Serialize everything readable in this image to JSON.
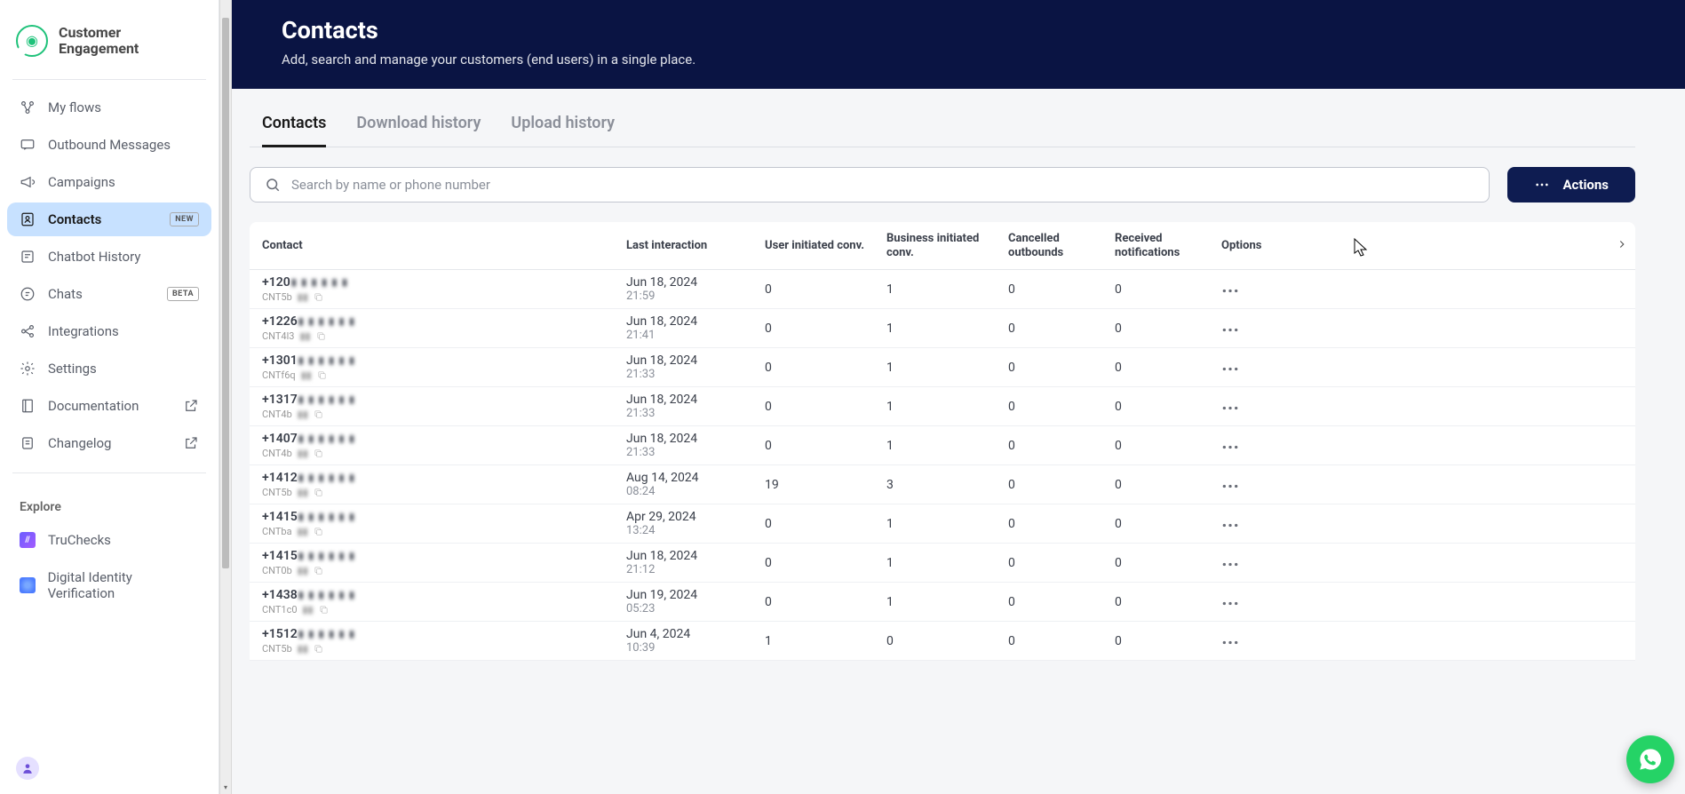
{
  "brand": {
    "line1": "Customer",
    "line2": "Engagement"
  },
  "sidebar": {
    "items": [
      {
        "label": "My flows"
      },
      {
        "label": "Outbound Messages"
      },
      {
        "label": "Campaigns"
      },
      {
        "label": "Contacts",
        "badge": "NEW"
      },
      {
        "label": "Chatbot History"
      },
      {
        "label": "Chats",
        "badge": "BETA"
      },
      {
        "label": "Integrations"
      },
      {
        "label": "Settings"
      },
      {
        "label": "Documentation"
      },
      {
        "label": "Changelog"
      }
    ],
    "explore_label": "Explore",
    "explore_items": [
      {
        "label": "TruChecks"
      },
      {
        "label": "Digital Identity Verification"
      }
    ]
  },
  "hero": {
    "title": "Contacts",
    "subtitle": "Add, search and manage your customers (end users) in a single place."
  },
  "tabs": [
    {
      "label": "Contacts",
      "active": true
    },
    {
      "label": "Download history"
    },
    {
      "label": "Upload history"
    }
  ],
  "search": {
    "placeholder": "Search by name or phone number",
    "value": ""
  },
  "actions_label": "Actions",
  "columns": {
    "contact": "Contact",
    "last": "Last interaction",
    "user_init": "User initiated conv.",
    "biz_init": "Business initiated conv.",
    "cancelled": "Cancelled outbounds",
    "received": "Received notifications",
    "options": "Options"
  },
  "rows": [
    {
      "phone_prefix": "+120",
      "code_prefix": "CNT5b",
      "date": "Jun 18, 2024",
      "time": "21:59",
      "ui": "0",
      "bi": "1",
      "co": "0",
      "rn": "0"
    },
    {
      "phone_prefix": "+1226",
      "code_prefix": "CNT4l3",
      "date": "Jun 18, 2024",
      "time": "21:41",
      "ui": "0",
      "bi": "1",
      "co": "0",
      "rn": "0"
    },
    {
      "phone_prefix": "+1301",
      "code_prefix": "CNTf6q",
      "date": "Jun 18, 2024",
      "time": "21:33",
      "ui": "0",
      "bi": "1",
      "co": "0",
      "rn": "0"
    },
    {
      "phone_prefix": "+1317",
      "code_prefix": "CNT4b",
      "date": "Jun 18, 2024",
      "time": "21:33",
      "ui": "0",
      "bi": "1",
      "co": "0",
      "rn": "0"
    },
    {
      "phone_prefix": "+1407",
      "code_prefix": "CNT4b",
      "date": "Jun 18, 2024",
      "time": "21:33",
      "ui": "0",
      "bi": "1",
      "co": "0",
      "rn": "0"
    },
    {
      "phone_prefix": "+1412",
      "code_prefix": "CNT5b",
      "date": "Aug 14, 2024",
      "time": "08:24",
      "ui": "19",
      "bi": "3",
      "co": "0",
      "rn": "0"
    },
    {
      "phone_prefix": "+1415",
      "code_prefix": "CNTba",
      "date": "Apr 29, 2024",
      "time": "13:24",
      "ui": "0",
      "bi": "1",
      "co": "0",
      "rn": "0"
    },
    {
      "phone_prefix": "+1415",
      "code_prefix": "CNT0b",
      "date": "Jun 18, 2024",
      "time": "21:12",
      "ui": "0",
      "bi": "1",
      "co": "0",
      "rn": "0"
    },
    {
      "phone_prefix": "+1438",
      "code_prefix": "CNT1c0",
      "date": "Jun 19, 2024",
      "time": "05:23",
      "ui": "0",
      "bi": "1",
      "co": "0",
      "rn": "0"
    },
    {
      "phone_prefix": "+1512",
      "code_prefix": "CNT5b",
      "date": "Jun 4, 2024",
      "time": "10:39",
      "ui": "1",
      "bi": "0",
      "co": "0",
      "rn": "0"
    }
  ]
}
